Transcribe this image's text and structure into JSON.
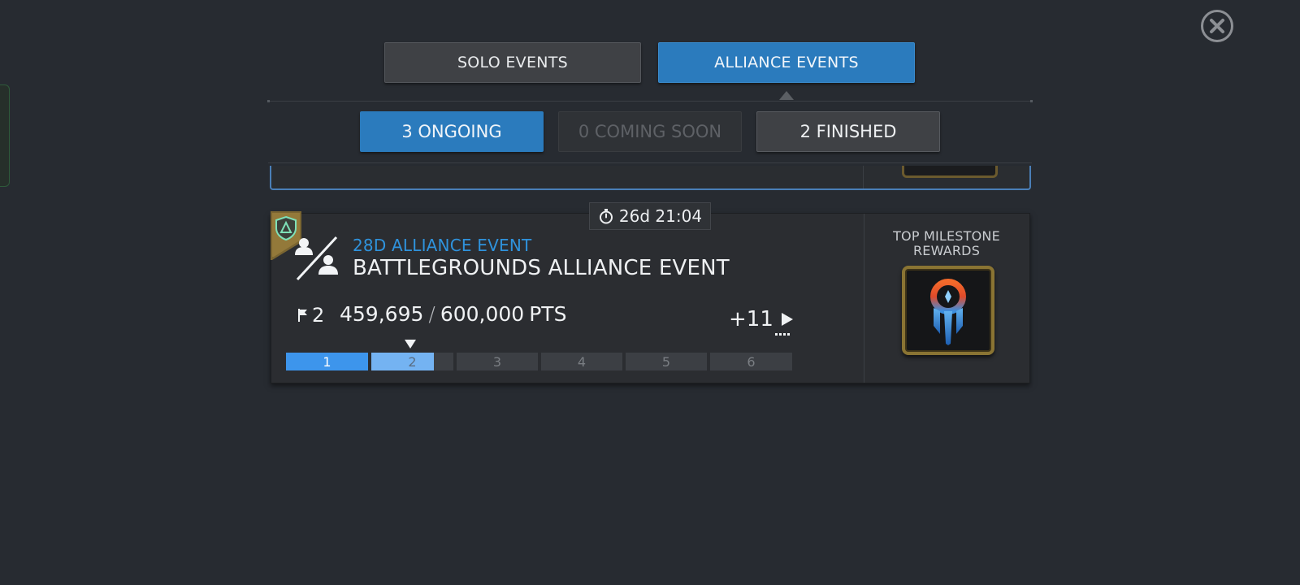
{
  "tabs": {
    "solo_label": "SOLO EVENTS",
    "alliance_label": "ALLIANCE EVENTS",
    "active": "alliance"
  },
  "filters": {
    "ongoing_label": "3 ONGOING",
    "coming_soon_label": "0 COMING SOON",
    "finished_label": "2 FINISHED",
    "active": "ongoing"
  },
  "event_card": {
    "timer": "26d 21:04",
    "event_type": "28D ALLIANCE EVENT",
    "title": "BATTLEGROUNDS ALLIANCE EVENT",
    "current_milestone": "2",
    "points_current": "459,695",
    "points_target": "600,000",
    "points_unit": "PTS",
    "more_milestones": "+11",
    "milestones": [
      "1",
      "2",
      "3",
      "4",
      "5",
      "6"
    ],
    "progress_in_milestone_2": 0.76,
    "reward_header": "TOP MILESTONE REWARDS"
  },
  "colors": {
    "accent_blue": "#2b7bbd",
    "event_type_blue": "#2f93dd",
    "progress_blue": "#3d95ec",
    "progress_light": "#74b3f2",
    "background": "#272b31"
  },
  "icons": {
    "close": "close-icon",
    "timer": "stopwatch-icon",
    "flag": "flag-icon",
    "play": "play-icon",
    "battle": "battlegrounds-icon",
    "alliance_shield": "alliance-shield-icon",
    "reward": "crystal-reward-icon"
  }
}
